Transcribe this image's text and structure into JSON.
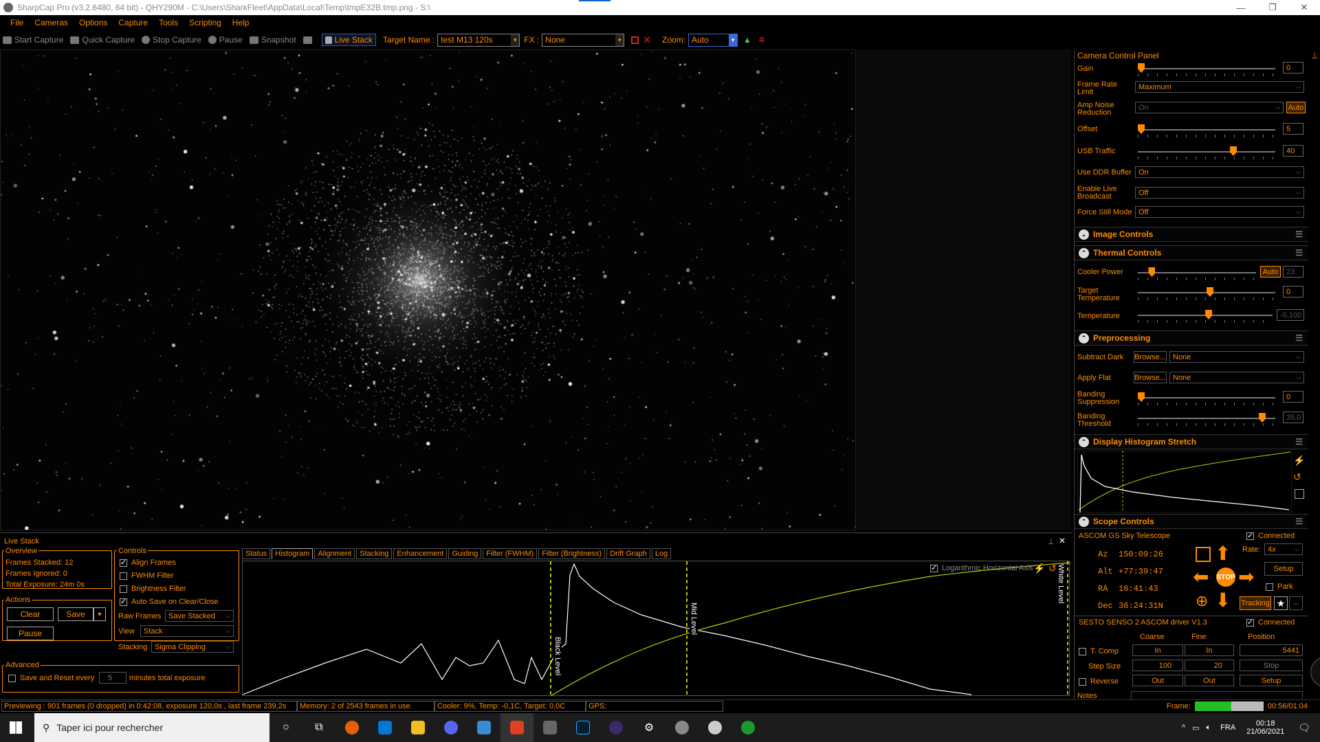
{
  "window": {
    "title": "SharpCap Pro (v3.2.6480, 64 bit) - QHY290M - C:\\Users\\SharkFleet\\AppData\\Local\\Temp\\tmpE32B.tmp.png - S:\\",
    "minimize": "—",
    "restore": "❐",
    "close": "✕"
  },
  "menu": [
    "File",
    "Cameras",
    "Options",
    "Capture",
    "Tools",
    "Scripting",
    "Help"
  ],
  "toolbar": {
    "start_capture": "Start Capture",
    "quick_capture": "Quick Capture",
    "stop_capture": "Stop Capture",
    "pause": "Pause",
    "snapshot": "Snapshot",
    "live_stack": "Live Stack",
    "target_name_label": "Target Name :",
    "target_name_value": "test M13 120s",
    "fx_label": "FX :",
    "fx_value": "None",
    "zoom_label": "Zoom:",
    "zoom_value": "Auto"
  },
  "panel": {
    "title": "Camera Control Panel",
    "gain": {
      "label": "Gain",
      "value": "0",
      "level": 0.0
    },
    "frame_rate": {
      "label": "Frame Rate Limit",
      "value": "Maximum"
    },
    "amp_noise": {
      "label": "Amp Noise Reduction",
      "value": "On",
      "auto": "Auto"
    },
    "offset": {
      "label": "Offset",
      "value": "5",
      "level": 0.0
    },
    "usb_traffic": {
      "label": "USB Traffic",
      "value": "40",
      "level": 0.67
    },
    "ddr_buffer": {
      "label": "Use DDR Buffer",
      "value": "On"
    },
    "live_broadcast": {
      "label": "Enable Live Broadcast",
      "value": "Off"
    },
    "force_still": {
      "label": "Force Still Mode",
      "value": "Off"
    },
    "image_controls": "Image Controls",
    "thermal_controls": "Thermal Controls",
    "cooler_power": {
      "label": "Cooler Power",
      "auto": "Auto",
      "value": "23",
      "level": 0.09
    },
    "target_temp": {
      "label": "Target Temperature",
      "value": "0",
      "level": 0.5
    },
    "temperature": {
      "label": "Temperature",
      "value": "-0,100",
      "level": 0.5
    },
    "preprocessing": "Preprocessing",
    "subtract_dark": {
      "label": "Subtract Dark",
      "browse": "Browse...",
      "value": "None"
    },
    "apply_flat": {
      "label": "Apply Flat",
      "browse": "Browse...",
      "value": "None"
    },
    "banding_suppression": {
      "label": "Banding Suppression",
      "value": "0",
      "level": 0.0
    },
    "banding_threshold": {
      "label": "Banding Threshold",
      "value": "35,0",
      "level": 0.88
    },
    "display_histogram": "Display Histogram Stretch",
    "scope_controls": "Scope Controls",
    "scope_name": "ASCOM GS Sky Telescope",
    "connected": "Connected",
    "az_label": "Az",
    "az": "150:09:26",
    "alt_label": "Alt",
    "alt": "+77:39:47",
    "ra_label": "RA",
    "ra": "16:41:43",
    "dec_label": "Dec",
    "dec": "36:24:31N",
    "rate_label": "Rate:",
    "rate": "4x",
    "setup": "Setup",
    "park": "Park",
    "stop": "STOP",
    "tracking": "Tracking",
    "focuser_name": "SESTO SENSO 2 ASCOM driver V1.3",
    "focuser_connected": "Connected",
    "coarse": "Coarse",
    "fine": "Fine",
    "position": "Position",
    "tcomp": "T. Comp",
    "in": "In",
    "in2": "In",
    "position_value": "5441",
    "step_size": "Step Size",
    "coarse_step": "100",
    "fine_step": "20",
    "stop2": "Stop",
    "reverse": "Reverse",
    "out": "Out",
    "out2": "Out",
    "setup2": "Setup",
    "notes": "Notes"
  },
  "livestack": {
    "title": "Live Stack",
    "overview": "Overview",
    "frames_stacked": "Frames Stacked:  12",
    "frames_ignored": "Frames Ignored:  0",
    "total_exposure": "Total Exposure:   24m 0s",
    "actions": "Actions",
    "clear": "Clear",
    "save": "Save",
    "pause": "Pause",
    "controls": "Controls",
    "align_frames": "Align Frames",
    "fwhm_filter": "FWHM Filter",
    "brightness_filter": "Brightness Filter",
    "auto_save": "Auto Save on Clear/Close",
    "raw_frames_label": "Raw Frames",
    "raw_frames": "Save Stacked",
    "view_label": "View",
    "view": "Stack",
    "stacking_label": "Stacking",
    "stacking": "Sigma Clipping",
    "advanced": "Advanced",
    "save_reset": "Save and Reset every",
    "minutes_value": "5",
    "minutes_label": "minutes total exposure",
    "tabs": [
      "Status",
      "Histogram",
      "Alignment",
      "Stacking",
      "Enhancement",
      "Guiding",
      "Filter (FWHM)",
      "Filter (Brightness)",
      "Drift Graph",
      "Log"
    ],
    "log_axis": "Logarithmic Horizontal Axis",
    "black_level": "Black Level",
    "mid_level": "Mid Level",
    "white_level": "White Level"
  },
  "status": {
    "preview": "Previewing : 901 frames (0 dropped) in 0:42:08, exposure 120,0s , last frame 239,2s",
    "memory": "Memory: 2 of 2543 frames in use.",
    "cooler": "Cooler: 9%, Temp: -0,1C, Target: 0,0C",
    "gps": "GPS:",
    "frame_label": "Frame:",
    "frame_time": "00:56/01:04",
    "frame_progress": 0.53
  },
  "taskbar": {
    "search": "Taper ici pour rechercher",
    "lang": "FRA",
    "time": "00:18",
    "date": "21/06/2021"
  },
  "colors": {
    "accent": "#ff8c00",
    "bg": "#000000",
    "histo_line": "#c8c800"
  }
}
